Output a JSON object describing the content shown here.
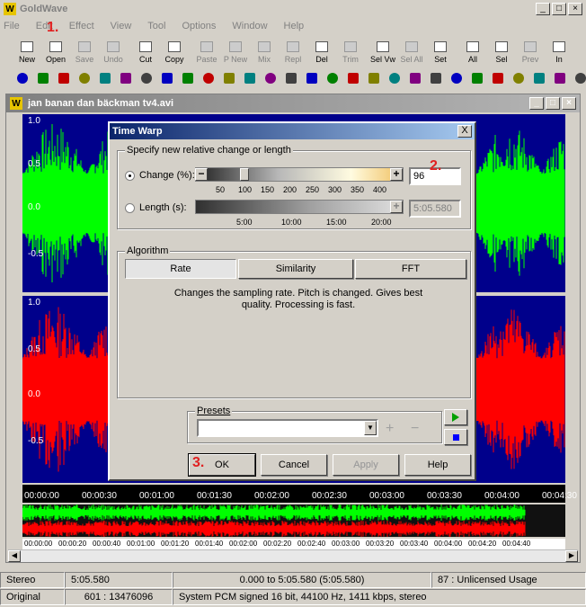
{
  "app": {
    "title": "GoldWave",
    "logo": "W"
  },
  "menu": [
    "File",
    "Edit",
    "Effect",
    "View",
    "Tool",
    "Options",
    "Window",
    "Help"
  ],
  "toolbar": [
    {
      "label": "New",
      "icon": "new-icon",
      "enabled": true
    },
    {
      "label": "Open",
      "icon": "open-icon",
      "enabled": true
    },
    {
      "label": "Save",
      "icon": "save-icon",
      "enabled": false
    },
    {
      "label": "Undo",
      "icon": "undo-icon",
      "enabled": false
    },
    {
      "label": "Cut",
      "icon": "cut-icon",
      "enabled": true
    },
    {
      "label": "Copy",
      "icon": "copy-icon",
      "enabled": true
    },
    {
      "label": "Paste",
      "icon": "paste-icon",
      "enabled": false
    },
    {
      "label": "P New",
      "icon": "paste-new-icon",
      "enabled": false
    },
    {
      "label": "Mix",
      "icon": "mix-icon",
      "enabled": false
    },
    {
      "label": "Repl",
      "icon": "replace-icon",
      "enabled": false
    },
    {
      "label": "Del",
      "icon": "delete-icon",
      "enabled": true
    },
    {
      "label": "Trim",
      "icon": "trim-icon",
      "enabled": false
    },
    {
      "label": "Sel Vw",
      "icon": "select-view-icon",
      "enabled": true
    },
    {
      "label": "Sel All",
      "icon": "select-all-icon",
      "enabled": false
    },
    {
      "label": "Set",
      "icon": "set-icon",
      "enabled": true
    },
    {
      "label": "All",
      "icon": "zoom-all-icon",
      "enabled": true
    },
    {
      "label": "Sel",
      "icon": "zoom-sel-icon",
      "enabled": true
    },
    {
      "label": "Prev",
      "icon": "zoom-prev-icon",
      "enabled": false
    },
    {
      "label": "In",
      "icon": "zoom-in-icon",
      "enabled": true
    }
  ],
  "effects_toolbar_count": 28,
  "document": {
    "title": "jan banan dan bäckman tv4.avi",
    "left_labels": [
      "1.0",
      "0.5",
      "0.0",
      "-0.5"
    ],
    "right_labels": [
      "1.0",
      "0.5",
      "0.0",
      "-0.5"
    ],
    "timeline": [
      "00:00:00",
      "00:00:30",
      "00:01:00",
      "00:01:30",
      "00:02:00",
      "00:02:30",
      "00:03:00",
      "00:03:30",
      "00:04:00",
      "00:04:30"
    ],
    "overview_ticks": [
      "00:00:00",
      "00:00:20",
      "00:00:40",
      "00:01:00",
      "00:01:20",
      "00:01:40",
      "00:02:00",
      "00:02:20",
      "00:02:40",
      "00:03:00",
      "00:03:20",
      "00:03:40",
      "00:04:00",
      "00:04:20",
      "00:04:40"
    ]
  },
  "dialog": {
    "title": "Time Warp",
    "close": "X",
    "group1_label": "Specify new relative change or length",
    "change_label": "Change (%):",
    "change_value": "96",
    "change_ticks": [
      "50",
      "100",
      "150",
      "200",
      "250",
      "300",
      "350",
      "400"
    ],
    "length_label": "Length (s):",
    "length_value": "5:05.580",
    "length_ticks": [
      "5:00",
      "10:00",
      "15:00",
      "20:00"
    ],
    "algorithm_label": "Algorithm",
    "algorithms": [
      "Rate",
      "Similarity",
      "FFT"
    ],
    "algorithm_desc": "Changes the sampling rate.  Pitch is changed.  Gives best quality.  Processing is fast.",
    "presets_label": "Presets",
    "presets_value": "",
    "buttons": {
      "ok": "OK",
      "cancel": "Cancel",
      "apply": "Apply",
      "help": "Help"
    },
    "minus": "−",
    "plus": "+"
  },
  "annotations": {
    "step1": "1.",
    "step2": "2.",
    "step3": "3."
  },
  "status": {
    "channels": "Stereo",
    "length": "5:05.580",
    "selection": "0.000 to 5:05.580 (5:05.580)",
    "license": "87 : Unlicensed Usage",
    "mode": "Original",
    "position": "601 : 13476096",
    "format": "System PCM signed 16 bit, 44100 Hz, 1411 kbps, stereo"
  },
  "colors": {
    "left_channel": "#00ff00",
    "right_channel": "#ff0000",
    "wave_bg": "#00008b",
    "annotation": "#e02020"
  }
}
